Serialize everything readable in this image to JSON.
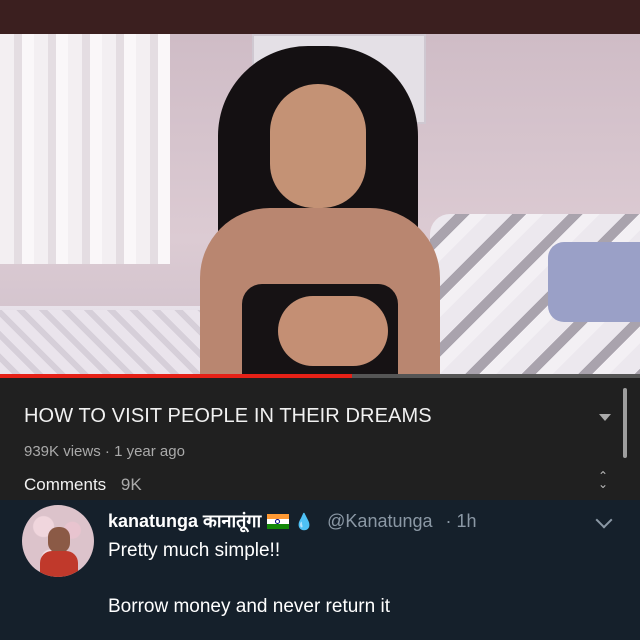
{
  "video": {
    "title": "HOW TO VISIT PEOPLE IN THEIR DREAMS",
    "views": "939K views",
    "age": "1 year ago",
    "comments_label": "Comments",
    "comments_count": "9K",
    "progress_fraction": 0.55,
    "progress_color": "#e62117"
  },
  "tweet": {
    "display_name": "kanatunga कानातूंगा",
    "handle": "@Kanatunga",
    "time": "1h",
    "text_line1": "Pretty much simple!!",
    "text_line2": "Borrow money and never return it",
    "emoji_flag": "india-flag-icon",
    "emoji_drop": "water-drop-icon"
  }
}
